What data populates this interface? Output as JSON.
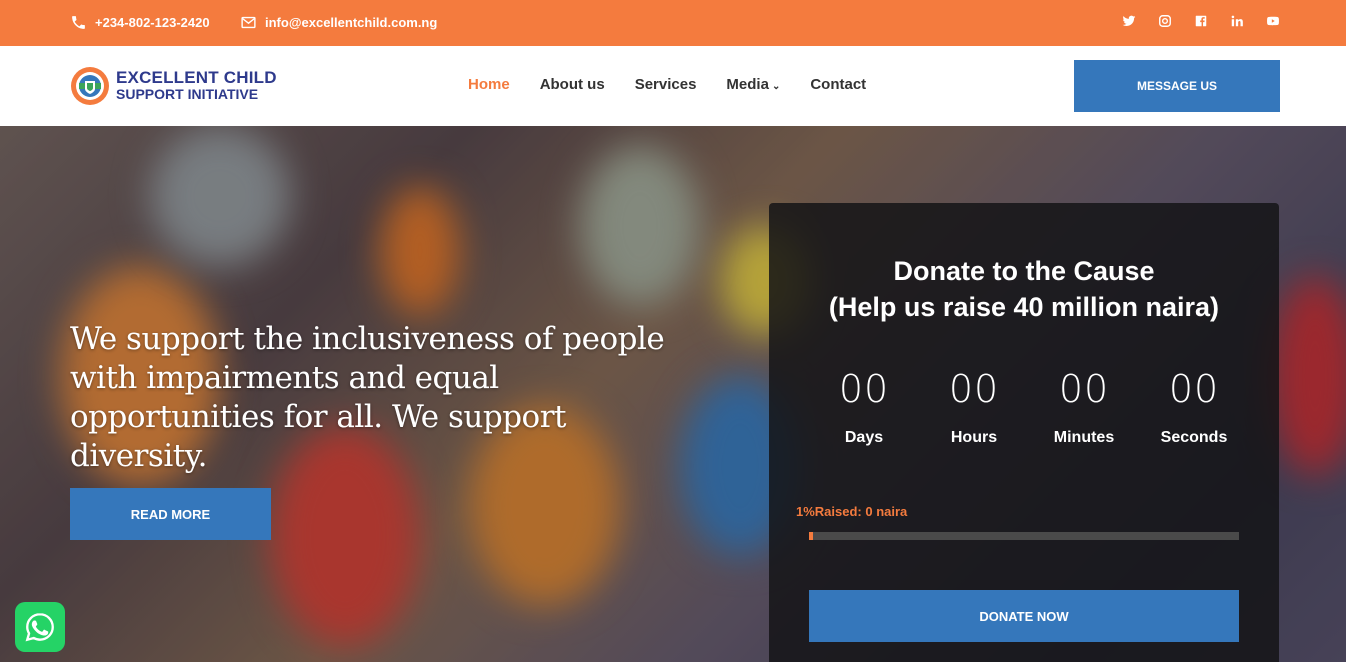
{
  "topbar": {
    "phone": "+234-802-123-2420",
    "email": "info@excellentchild.com.ng",
    "socials": [
      "twitter-icon",
      "instagram-icon",
      "facebook-icon",
      "linkedin-icon",
      "youtube-icon"
    ],
    "bg_color": "#f47b3e"
  },
  "header": {
    "logo_line1": "EXCELLENT CHILD",
    "logo_line2": "SUPPORT INITIATIVE",
    "nav": [
      {
        "label": "Home",
        "active": true
      },
      {
        "label": "About us"
      },
      {
        "label": "Services"
      },
      {
        "label": "Media",
        "has_dropdown": true
      },
      {
        "label": "Contact"
      }
    ],
    "message_button": "MESSAGE US"
  },
  "hero": {
    "heading": "We support the inclusiveness of people with impairments and equal opportunities for all. We support diversity.",
    "read_more": "READ MORE"
  },
  "donate": {
    "title_line1": "Donate to the Cause",
    "title_line2": "(Help us raise 40 million naira)",
    "countdown": [
      {
        "value": "00",
        "label": "Days"
      },
      {
        "value": "00",
        "label": "Hours"
      },
      {
        "value": "00",
        "label": "Minutes"
      },
      {
        "value": "00",
        "label": "Seconds"
      }
    ],
    "percent": "1%",
    "raised_text": "Raised: 0 naira",
    "progress_fraction": 0.01,
    "button": "DONATE NOW"
  },
  "colors": {
    "accent": "#f47b3e",
    "primary": "#3577bb"
  }
}
